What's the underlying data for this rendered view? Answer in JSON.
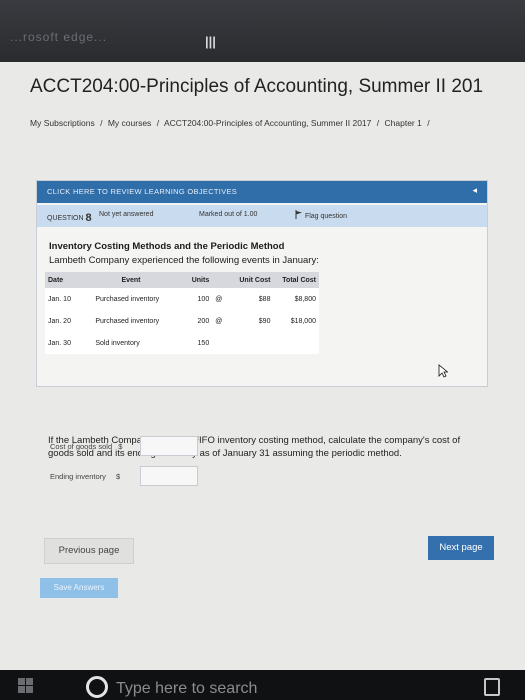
{
  "top_bar": {
    "blurred_text": "...rosoft edge..."
  },
  "page": {
    "course_title": "ACCT204:00-Principles of Accounting, Summer II 201",
    "breadcrumb": [
      "My Subscriptions",
      "My courses",
      "ACCT204:00-Principles of Accounting, Summer II 2017",
      "Chapter 1"
    ],
    "breadcrumb_separator": "/"
  },
  "learning_objectives_bar": {
    "label": "CLICK HERE TO REVIEW LEARNING OBJECTIVES"
  },
  "question_info": {
    "label": "QUESTION",
    "number": "8",
    "status": "Not yet answered",
    "marked": "Marked out of 1.00",
    "flag_label": "Flag question"
  },
  "problem": {
    "title": "Inventory Costing Methods and the Periodic Method",
    "intro": "Lambeth Company experienced the following events in January:",
    "table": {
      "headers": [
        "Date",
        "Event",
        "Units",
        "Unit Cost",
        "Total Cost"
      ],
      "rows": [
        {
          "date": "Jan. 10",
          "event": "Purchased inventory",
          "units": "100",
          "at": "@",
          "unit_cost": "$88",
          "total_cost": "$8,800"
        },
        {
          "date": "Jan. 20",
          "event": "Purchased inventory",
          "units": "200",
          "at": "@",
          "unit_cost": "$90",
          "total_cost": "$18,000"
        },
        {
          "date": "Jan. 30",
          "event": "Sold inventory",
          "units": "150",
          "at": "",
          "unit_cost": "",
          "total_cost": ""
        }
      ]
    }
  },
  "question_text": "If the Lambeth Company uses the FIFO inventory costing method, calculate the company's cost of goods sold and its ending inventory as of January 31 assuming the periodic method.",
  "answers": {
    "cogs_label": "Cost of goods sold",
    "ending_label": "Ending inventory",
    "currency": "$",
    "cogs_value": "",
    "ending_value": ""
  },
  "buttons": {
    "previous": "Previous page",
    "next": "Next page",
    "save": "Save Answers"
  },
  "taskbar": {
    "search_placeholder": "Type here to search"
  },
  "colors": {
    "accent": "#3370ad",
    "lo_bar": "#2f6ea9",
    "qinfo": "#c9dbee"
  },
  "icons": [
    "menu-icon",
    "flag-icon",
    "collapse-icon",
    "cursor-icon",
    "windows-start-icon",
    "cortana-icon",
    "tray-icon"
  ]
}
